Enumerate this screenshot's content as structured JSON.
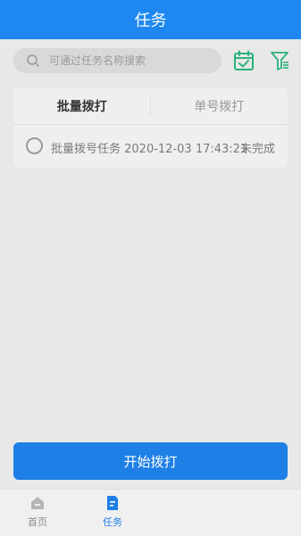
{
  "header": {
    "title": "任务"
  },
  "search": {
    "placeholder": "可通过任务名称搜索"
  },
  "tabs": [
    {
      "label": "批量拨打",
      "active": true
    },
    {
      "label": "单号拨打",
      "active": false
    }
  ],
  "tasks": [
    {
      "name": "批量拨号任务 2020-12-03 17:43:21",
      "status": "未完成"
    }
  ],
  "actions": {
    "start_label": "开始拨打"
  },
  "nav": {
    "home_label": "首页",
    "task_label": "任务"
  },
  "colors": {
    "primary": "#1e88f0",
    "accent_green": "#2ab27b"
  }
}
